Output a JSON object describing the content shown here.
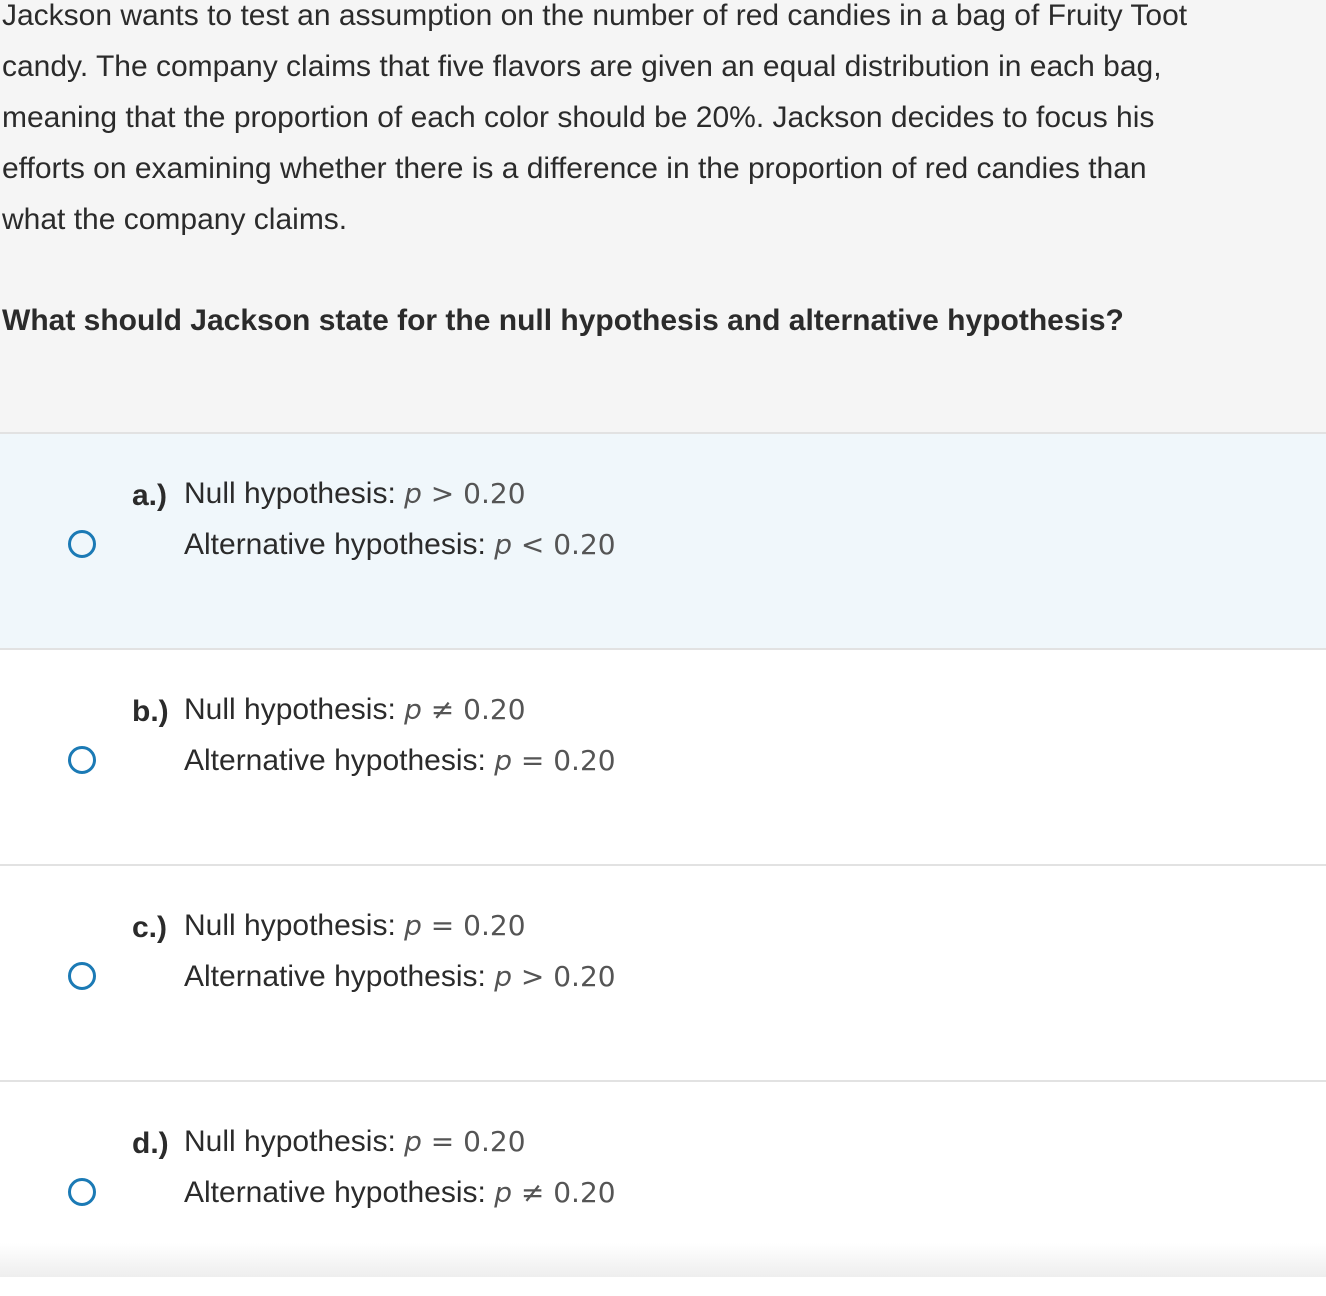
{
  "question": {
    "prompt_lines": [
      "Jackson wants to test an assumption on the number of red candies in a bag of Fruity Toot",
      "candy. The company claims that five flavors are given an equal distribution in each bag,",
      "meaning that the proportion of each color should be 20%. Jackson decides to focus his",
      "efforts on examining whether there is a difference in the proportion of red candies than",
      "what the company claims."
    ],
    "ask": "What should Jackson state for the null hypothesis and alternative hypothesis?"
  },
  "options": [
    {
      "letter": "a.)",
      "null_label": "Null hypothesis:",
      "null_var": "p",
      "null_expr": " > 0.20",
      "alt_label": "Alternative hypothesis:",
      "alt_var": "p",
      "alt_expr": " < 0.20"
    },
    {
      "letter": "b.)",
      "null_label": "Null hypothesis:",
      "null_var": "p",
      "null_expr": " ≠ 0.20",
      "alt_label": "Alternative hypothesis:",
      "alt_var": "p",
      "alt_expr": " = 0.20"
    },
    {
      "letter": "c.)",
      "null_label": "Null hypothesis:",
      "null_var": "p",
      "null_expr": " = 0.20",
      "alt_label": "Alternative hypothesis:",
      "alt_var": "p",
      "alt_expr": " > 0.20"
    },
    {
      "letter": "d.)",
      "null_label": "Null hypothesis:",
      "null_var": "p",
      "null_expr": " = 0.20",
      "alt_label": "Alternative hypothesis:",
      "alt_var": "p",
      "alt_expr": " ≠ 0.20"
    }
  ],
  "colors": {
    "radio_border": "#1b7ab5",
    "hover_background": "#f0f7fb",
    "question_background": "#f5f5f5"
  }
}
